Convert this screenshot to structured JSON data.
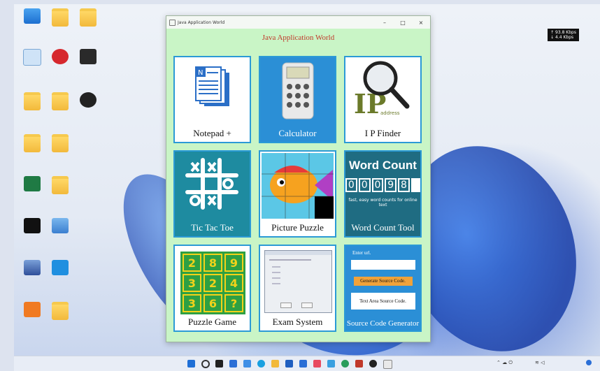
{
  "window": {
    "title": "Java Application World",
    "min": "–",
    "max": "□",
    "close": "×"
  },
  "app": {
    "heading": "Java Application World"
  },
  "tiles": [
    {
      "label": "Notepad +"
    },
    {
      "label": "Calculator"
    },
    {
      "label": "I P Finder"
    },
    {
      "label": "Tic Tac Toe"
    },
    {
      "label": "Picture Puzzle"
    },
    {
      "label": "Word Count Tool",
      "title": "Word Count",
      "digits": [
        "0",
        "0",
        "0",
        "9",
        "8"
      ],
      "tagline": "fast, easy word counts for online text"
    },
    {
      "label": "Puzzle Game",
      "cells": [
        "2",
        "8",
        "9",
        "3",
        "2",
        "4",
        "3",
        "6",
        "?"
      ]
    },
    {
      "label": "Exam System"
    },
    {
      "label": "Source Code Generator",
      "url_label": "Enter url.",
      "button": "Generate Source Code.",
      "area": "Text Area Source Code."
    }
  ],
  "ipfinder": {
    "ip": "IP",
    "address": "address"
  },
  "network": {
    "up": "↑ 93.8 Kbps",
    "down": "↓ 4.4 Kbps"
  },
  "colors": {
    "window_bg": "#c9f5c6",
    "tile_border": "#2b9ad6",
    "title_red": "#c0392b",
    "calc_blue": "#2b8fd6",
    "teal": "#1e8ba0",
    "puzzle_green": "#2ea043"
  }
}
